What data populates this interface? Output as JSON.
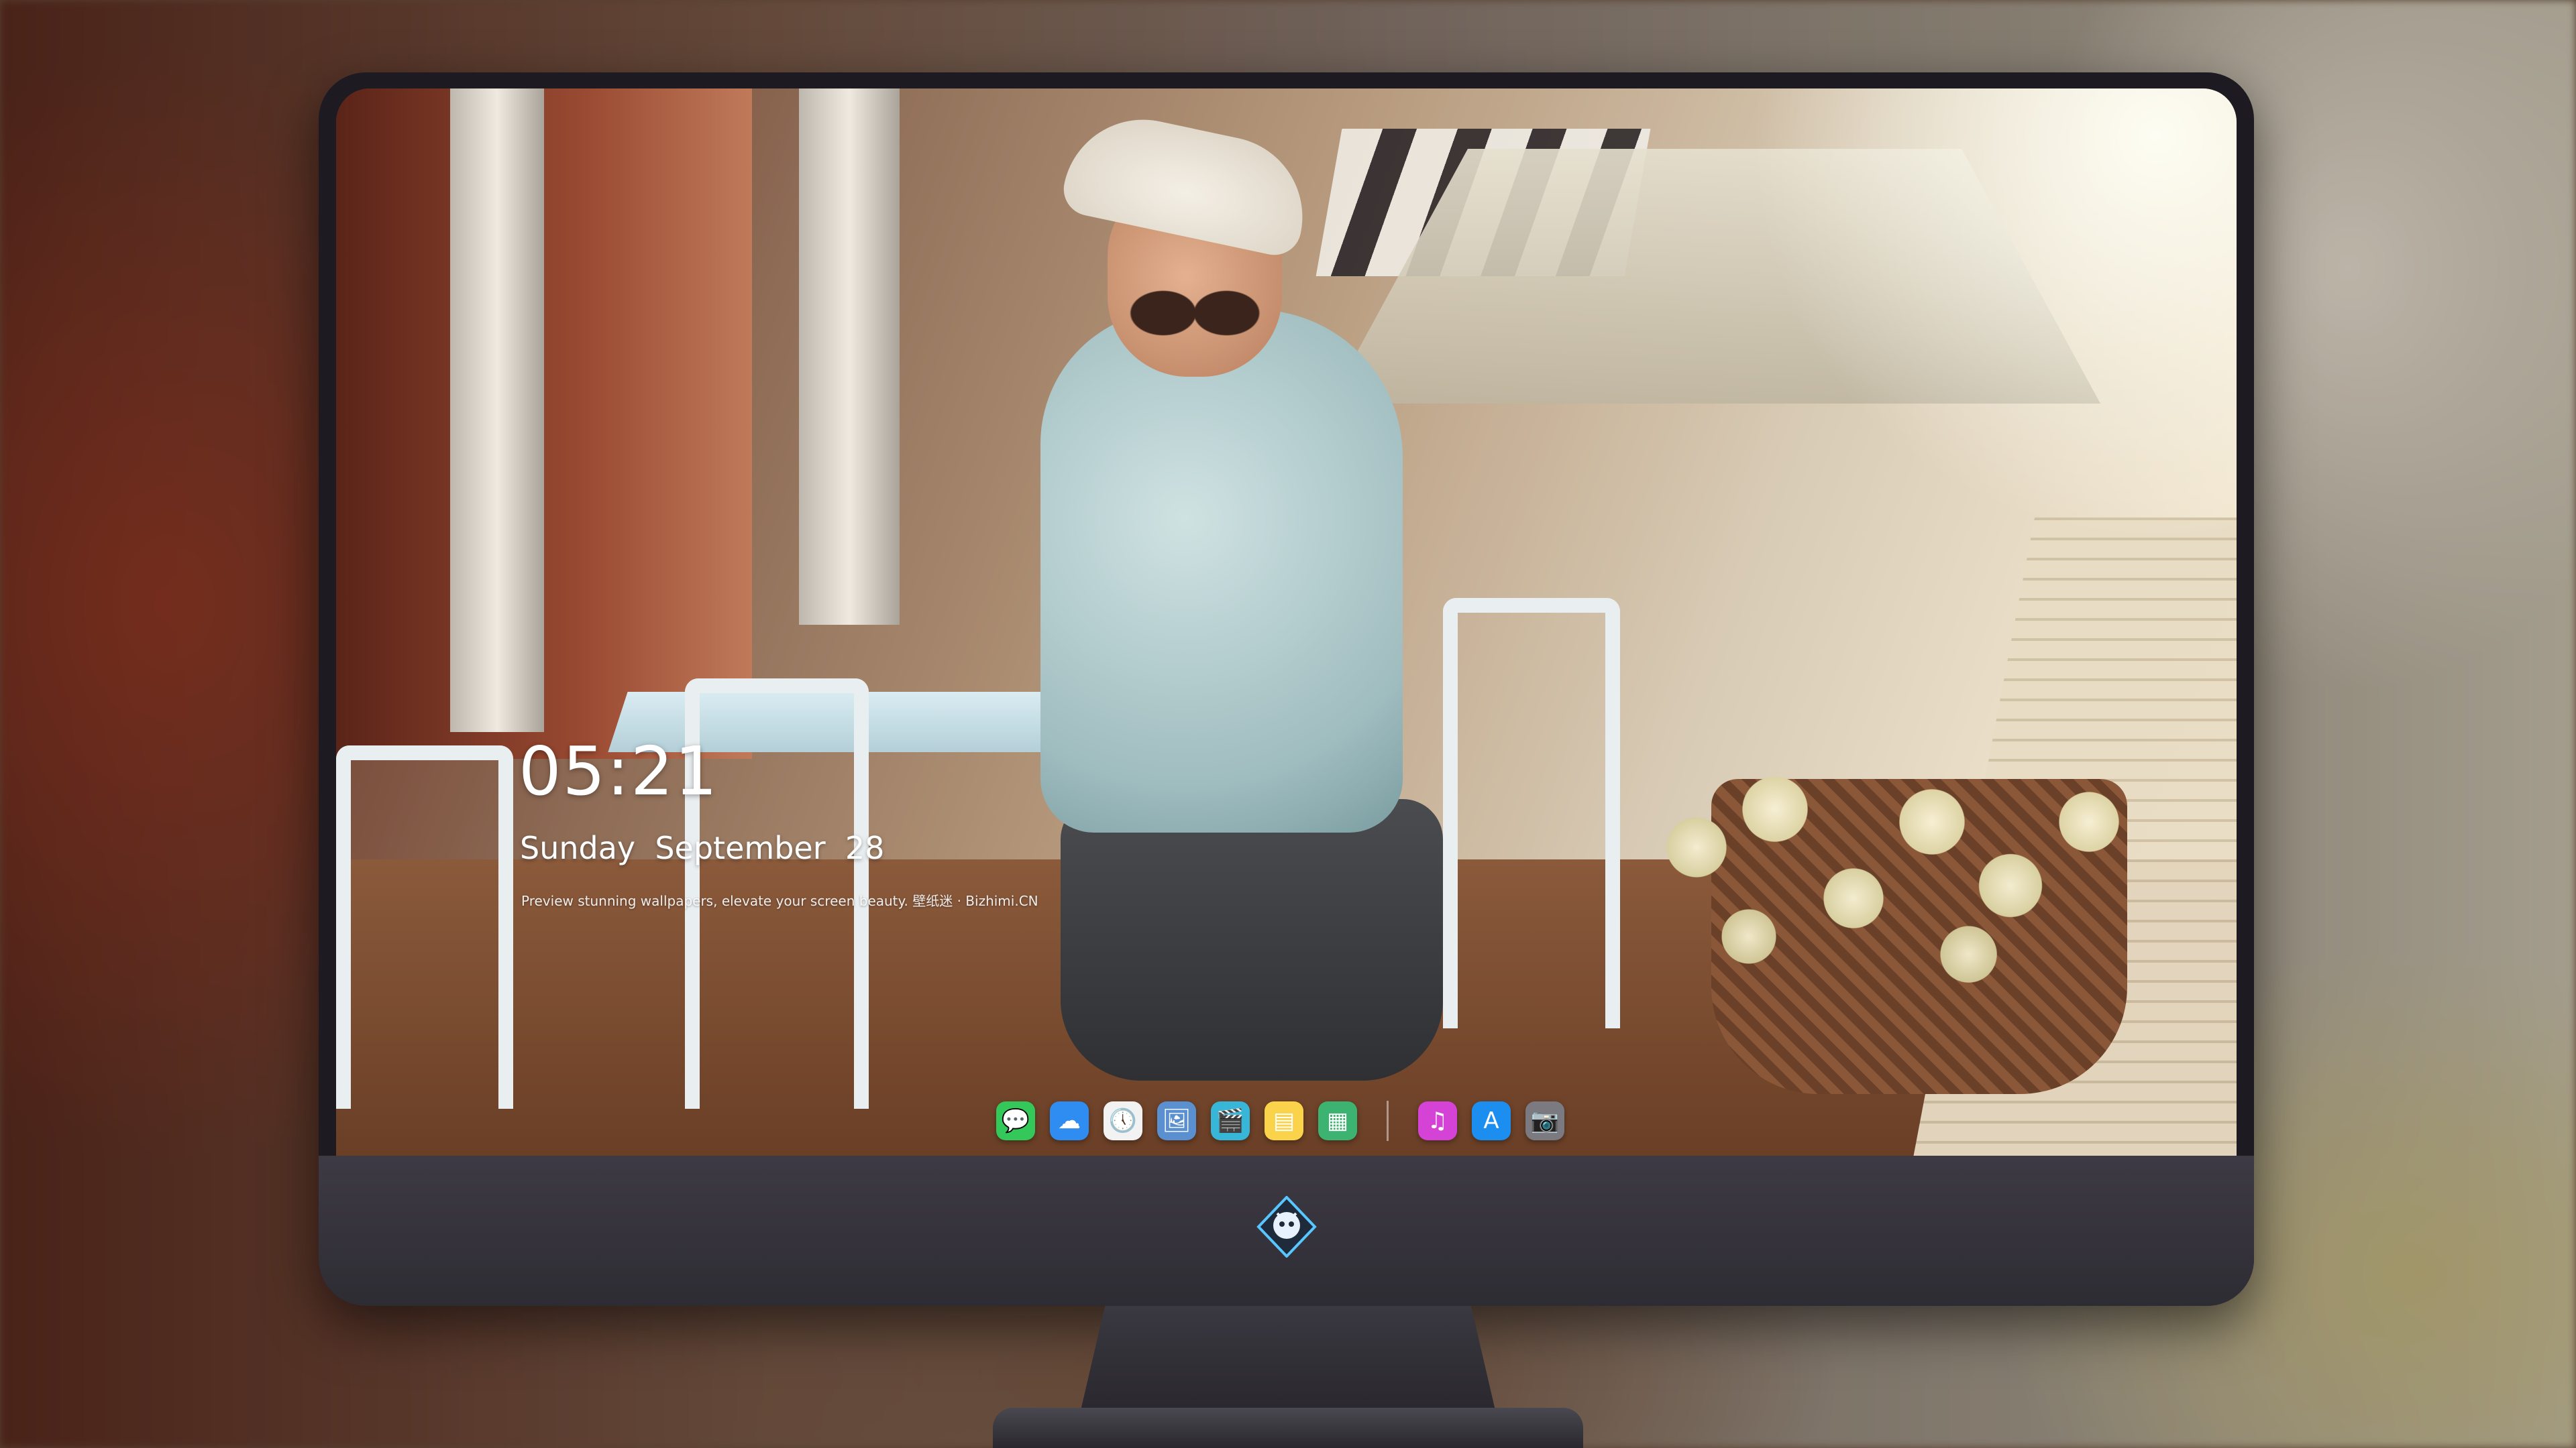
{
  "lock_screen": {
    "time": "05:21",
    "date": "Sunday  September  28",
    "tagline": "Preview stunning wallpapers, elevate your screen beauty. 壁纸迷 · Bizhimi.CN"
  },
  "dock": {
    "apps": [
      {
        "name": "messages-icon",
        "glyph": "💬",
        "color": "#34c759"
      },
      {
        "name": "weather-icon",
        "glyph": "☁",
        "color": "#2f8cf0"
      },
      {
        "name": "clock-icon",
        "glyph": "🕔",
        "color": "#f2f2f2"
      },
      {
        "name": "preview-icon",
        "glyph": "🖼",
        "color": "#5a8fd0"
      },
      {
        "name": "claquette-icon",
        "glyph": "🎬",
        "color": "#38b6d8"
      },
      {
        "name": "notes-icon",
        "glyph": "▤",
        "color": "#fbd34a"
      },
      {
        "name": "numbers-icon",
        "glyph": "▦",
        "color": "#3cb371"
      },
      {
        "name": "music-icon",
        "glyph": "♫",
        "color": "#d442d6"
      },
      {
        "name": "app-store-icon",
        "glyph": "A",
        "color": "#1c8ef0"
      },
      {
        "name": "camera-icon",
        "glyph": "📷",
        "color": "#7a7a80"
      }
    ]
  },
  "monitor": {
    "logo_name": "dragon-logo-icon"
  }
}
